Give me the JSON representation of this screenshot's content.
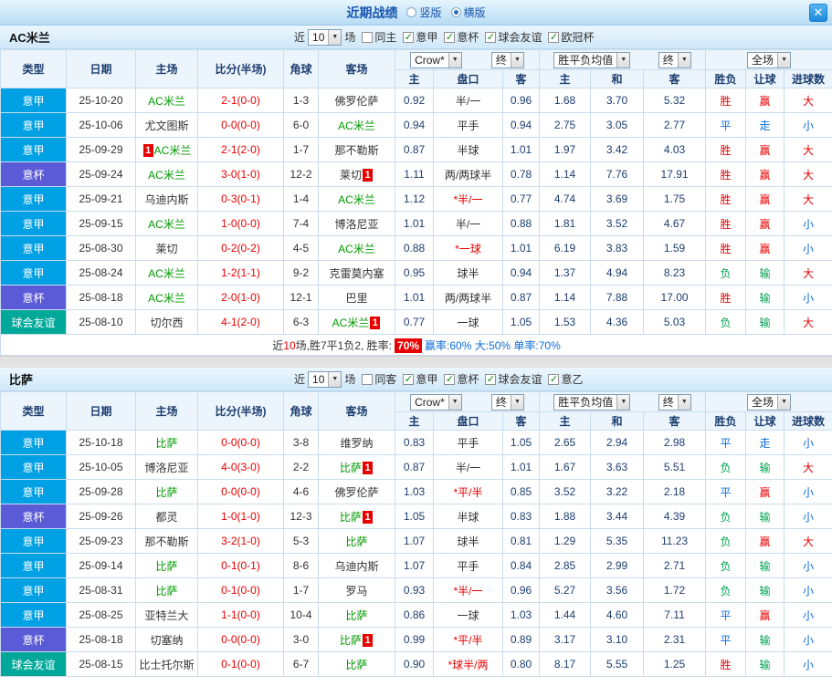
{
  "topbar": {
    "title": "近期战绩",
    "vertical_label": "竖版",
    "horizontal_label": "横版"
  },
  "icons": {
    "close": "✕",
    "dropdown": "▼",
    "check": "✓"
  },
  "table": {
    "near_label": "近",
    "matches_label": "场",
    "headers_left": [
      "类型",
      "日期",
      "主场",
      "比分(半场)",
      "角球",
      "客场"
    ],
    "headers_right": [
      "主",
      "盘口",
      "客",
      "主",
      "和",
      "客",
      "胜负",
      "让球",
      "进球数"
    ]
  },
  "league_colors": {
    "意甲": "#00a0e4",
    "意杯": "#5b5bd8",
    "球会友谊": "#00a89a"
  },
  "result_colors": {
    "r": "#e80000",
    "g": "#00a050",
    "b": "#0a6cdc"
  },
  "sections": [
    {
      "team": "AC米兰",
      "count": "10",
      "same_label": "同主",
      "leagues": [
        "意甲",
        "意杯",
        "球会友谊",
        "欧冠杯"
      ],
      "select_groups": [
        [
          "Crow*",
          "终"
        ],
        [
          "胜平负均值",
          "终"
        ],
        [
          "全场"
        ]
      ],
      "rows": [
        {
          "league": "意甲",
          "date": "25-10-20",
          "home": {
            "name": "AC米兰",
            "green": true
          },
          "score": "2-1(0-0)",
          "corner": "1-3",
          "away": {
            "name": "佛罗伦萨",
            "green": false
          },
          "crow_home": "0.92",
          "handicap": "半/一",
          "handicap_red": false,
          "crow_away": "0.96",
          "avg_home": "1.68",
          "avg_draw": "3.70",
          "avg_away": "5.32",
          "result": {
            "t": "胜",
            "c": "r"
          },
          "handicap_result": {
            "t": "赢",
            "c": "r"
          },
          "goals": {
            "t": "大",
            "c": "r"
          }
        },
        {
          "league": "意甲",
          "date": "25-10-06",
          "home": {
            "name": "尤文图斯",
            "green": false
          },
          "score": "0-0(0-0)",
          "corner": "6-0",
          "away": {
            "name": "AC米兰",
            "green": true
          },
          "crow_home": "0.94",
          "handicap": "平手",
          "handicap_red": false,
          "crow_away": "0.94",
          "avg_home": "2.75",
          "avg_draw": "3.05",
          "avg_away": "2.77",
          "result": {
            "t": "平",
            "c": "b"
          },
          "handicap_result": {
            "t": "走",
            "c": "b"
          },
          "goals": {
            "t": "小",
            "c": "b"
          }
        },
        {
          "league": "意甲",
          "date": "25-09-29",
          "home": {
            "name": "AC米兰",
            "green": true,
            "badge": "1",
            "badge_pos": "before"
          },
          "score": "2-1(2-0)",
          "corner": "1-7",
          "away": {
            "name": "那不勒斯",
            "green": false
          },
          "crow_home": "0.87",
          "handicap": "半球",
          "handicap_red": false,
          "crow_away": "1.01",
          "avg_home": "1.97",
          "avg_draw": "3.42",
          "avg_away": "4.03",
          "result": {
            "t": "胜",
            "c": "r"
          },
          "handicap_result": {
            "t": "赢",
            "c": "r"
          },
          "goals": {
            "t": "大",
            "c": "r"
          }
        },
        {
          "league": "意杯",
          "date": "25-09-24",
          "home": {
            "name": "AC米兰",
            "green": true
          },
          "score": "3-0(1-0)",
          "corner": "12-2",
          "away": {
            "name": "莱切",
            "green": false,
            "badge": "1",
            "badge_pos": "after"
          },
          "crow_home": "1.11",
          "handicap": "两/两球半",
          "handicap_red": false,
          "crow_away": "0.78",
          "avg_home": "1.14",
          "avg_draw": "7.76",
          "avg_away": "17.91",
          "result": {
            "t": "胜",
            "c": "r"
          },
          "handicap_result": {
            "t": "赢",
            "c": "r"
          },
          "goals": {
            "t": "大",
            "c": "r"
          }
        },
        {
          "league": "意甲",
          "date": "25-09-21",
          "home": {
            "name": "乌迪内斯",
            "green": false
          },
          "score": "0-3(0-1)",
          "corner": "1-4",
          "away": {
            "name": "AC米兰",
            "green": true
          },
          "crow_home": "1.12",
          "handicap": "*半/一",
          "handicap_red": true,
          "crow_away": "0.77",
          "avg_home": "4.74",
          "avg_draw": "3.69",
          "avg_away": "1.75",
          "result": {
            "t": "胜",
            "c": "r"
          },
          "handicap_result": {
            "t": "赢",
            "c": "r"
          },
          "goals": {
            "t": "大",
            "c": "r"
          }
        },
        {
          "league": "意甲",
          "date": "25-09-15",
          "home": {
            "name": "AC米兰",
            "green": true
          },
          "score": "1-0(0-0)",
          "corner": "7-4",
          "away": {
            "name": "博洛尼亚",
            "green": false
          },
          "crow_home": "1.01",
          "handicap": "半/一",
          "handicap_red": false,
          "crow_away": "0.88",
          "avg_home": "1.81",
          "avg_draw": "3.52",
          "avg_away": "4.67",
          "result": {
            "t": "胜",
            "c": "r"
          },
          "handicap_result": {
            "t": "赢",
            "c": "r"
          },
          "goals": {
            "t": "小",
            "c": "b"
          }
        },
        {
          "league": "意甲",
          "date": "25-08-30",
          "home": {
            "name": "莱切",
            "green": false
          },
          "score": "0-2(0-2)",
          "corner": "4-5",
          "away": {
            "name": "AC米兰",
            "green": true
          },
          "crow_home": "0.88",
          "handicap": "*一球",
          "handicap_red": true,
          "crow_away": "1.01",
          "avg_home": "6.19",
          "avg_draw": "3.83",
          "avg_away": "1.59",
          "result": {
            "t": "胜",
            "c": "r"
          },
          "handicap_result": {
            "t": "赢",
            "c": "r"
          },
          "goals": {
            "t": "小",
            "c": "b"
          }
        },
        {
          "league": "意甲",
          "date": "25-08-24",
          "home": {
            "name": "AC米兰",
            "green": true
          },
          "score": "1-2(1-1)",
          "corner": "9-2",
          "away": {
            "name": "克雷莫内塞",
            "green": false
          },
          "crow_home": "0.95",
          "handicap": "球半",
          "handicap_red": false,
          "crow_away": "0.94",
          "avg_home": "1.37",
          "avg_draw": "4.94",
          "avg_away": "8.23",
          "result": {
            "t": "负",
            "c": "g"
          },
          "handicap_result": {
            "t": "输",
            "c": "g"
          },
          "goals": {
            "t": "大",
            "c": "r"
          }
        },
        {
          "league": "意杯",
          "date": "25-08-18",
          "home": {
            "name": "AC米兰",
            "green": true
          },
          "score": "2-0(1-0)",
          "corner": "12-1",
          "away": {
            "name": "巴里",
            "green": false
          },
          "crow_home": "1.01",
          "handicap": "两/两球半",
          "handicap_red": false,
          "crow_away": "0.87",
          "avg_home": "1.14",
          "avg_draw": "7.88",
          "avg_away": "17.00",
          "result": {
            "t": "胜",
            "c": "r"
          },
          "handicap_result": {
            "t": "输",
            "c": "g"
          },
          "goals": {
            "t": "小",
            "c": "b"
          }
        },
        {
          "league": "球会友谊",
          "date": "25-08-10",
          "home": {
            "name": "切尔西",
            "green": false
          },
          "score": "4-1(2-0)",
          "corner": "6-3",
          "away": {
            "name": "AC米兰",
            "green": true,
            "badge": "1",
            "badge_pos": "after"
          },
          "crow_home": "0.77",
          "handicap": "一球",
          "handicap_red": false,
          "crow_away": "1.05",
          "avg_home": "1.53",
          "avg_draw": "4.36",
          "avg_away": "5.03",
          "result": {
            "t": "负",
            "c": "g"
          },
          "handicap_result": {
            "t": "输",
            "c": "g"
          },
          "goals": {
            "t": "大",
            "c": "r"
          }
        }
      ],
      "summary": [
        {
          "t": "近",
          "c": "#333333"
        },
        {
          "t": "10",
          "c": "#e80000"
        },
        {
          "t": "场,胜7平1负2, 胜率:",
          "c": "#333333"
        },
        {
          "t": "70%",
          "badge": true
        },
        {
          "t": "赢率:60% 大:50% 单率:70%",
          "c": "#0a6cdc"
        }
      ]
    },
    {
      "team": "比萨",
      "count": "10",
      "same_label": "同客",
      "leagues": [
        "意甲",
        "意杯",
        "球会友谊",
        "意乙"
      ],
      "select_groups": [
        [
          "Crow*",
          "终"
        ],
        [
          "胜平负均值",
          "终"
        ],
        [
          "全场"
        ]
      ],
      "rows": [
        {
          "league": "意甲",
          "date": "25-10-18",
          "home": {
            "name": "比萨",
            "green": true
          },
          "score": "0-0(0-0)",
          "corner": "3-8",
          "away": {
            "name": "维罗纳",
            "green": false
          },
          "crow_home": "0.83",
          "handicap": "平手",
          "handicap_red": false,
          "crow_away": "1.05",
          "avg_home": "2.65",
          "avg_draw": "2.94",
          "avg_away": "2.98",
          "result": {
            "t": "平",
            "c": "b"
          },
          "handicap_result": {
            "t": "走",
            "c": "b"
          },
          "goals": {
            "t": "小",
            "c": "b"
          }
        },
        {
          "league": "意甲",
          "date": "25-10-05",
          "home": {
            "name": "博洛尼亚",
            "green": false
          },
          "score": "4-0(3-0)",
          "corner": "2-2",
          "away": {
            "name": "比萨",
            "green": true,
            "badge": "1",
            "badge_pos": "after"
          },
          "crow_home": "0.87",
          "handicap": "半/一",
          "handicap_red": false,
          "crow_away": "1.01",
          "avg_home": "1.67",
          "avg_draw": "3.63",
          "avg_away": "5.51",
          "result": {
            "t": "负",
            "c": "g"
          },
          "handicap_result": {
            "t": "输",
            "c": "g"
          },
          "goals": {
            "t": "大",
            "c": "r"
          }
        },
        {
          "league": "意甲",
          "date": "25-09-28",
          "home": {
            "name": "比萨",
            "green": true
          },
          "score": "0-0(0-0)",
          "corner": "4-6",
          "away": {
            "name": "佛罗伦萨",
            "green": false
          },
          "crow_home": "1.03",
          "handicap": "*平/半",
          "handicap_red": true,
          "crow_away": "0.85",
          "avg_home": "3.52",
          "avg_draw": "3.22",
          "avg_away": "2.18",
          "result": {
            "t": "平",
            "c": "b"
          },
          "handicap_result": {
            "t": "赢",
            "c": "r"
          },
          "goals": {
            "t": "小",
            "c": "b"
          }
        },
        {
          "league": "意杯",
          "date": "25-09-26",
          "home": {
            "name": "都灵",
            "green": false
          },
          "score": "1-0(1-0)",
          "corner": "12-3",
          "away": {
            "name": "比萨",
            "green": true,
            "badge": "1",
            "badge_pos": "after"
          },
          "crow_home": "1.05",
          "handicap": "半球",
          "handicap_red": false,
          "crow_away": "0.83",
          "avg_home": "1.88",
          "avg_draw": "3.44",
          "avg_away": "4.39",
          "result": {
            "t": "负",
            "c": "g"
          },
          "handicap_result": {
            "t": "输",
            "c": "g"
          },
          "goals": {
            "t": "小",
            "c": "b"
          }
        },
        {
          "league": "意甲",
          "date": "25-09-23",
          "home": {
            "name": "那不勒斯",
            "green": false
          },
          "score": "3-2(1-0)",
          "corner": "5-3",
          "away": {
            "name": "比萨",
            "green": true
          },
          "crow_home": "1.07",
          "handicap": "球半",
          "handicap_red": false,
          "crow_away": "0.81",
          "avg_home": "1.29",
          "avg_draw": "5.35",
          "avg_away": "11.23",
          "result": {
            "t": "负",
            "c": "g"
          },
          "handicap_result": {
            "t": "赢",
            "c": "r"
          },
          "goals": {
            "t": "大",
            "c": "r"
          }
        },
        {
          "league": "意甲",
          "date": "25-09-14",
          "home": {
            "name": "比萨",
            "green": true
          },
          "score": "0-1(0-1)",
          "corner": "8-6",
          "away": {
            "name": "乌迪内斯",
            "green": false
          },
          "crow_home": "1.07",
          "handicap": "平手",
          "handicap_red": false,
          "crow_away": "0.84",
          "avg_home": "2.85",
          "avg_draw": "2.99",
          "avg_away": "2.71",
          "result": {
            "t": "负",
            "c": "g"
          },
          "handicap_result": {
            "t": "输",
            "c": "g"
          },
          "goals": {
            "t": "小",
            "c": "b"
          }
        },
        {
          "league": "意甲",
          "date": "25-08-31",
          "home": {
            "name": "比萨",
            "green": true
          },
          "score": "0-1(0-0)",
          "corner": "1-7",
          "away": {
            "name": "罗马",
            "green": false
          },
          "crow_home": "0.93",
          "handicap": "*半/一",
          "handicap_red": true,
          "crow_away": "0.96",
          "avg_home": "5.27",
          "avg_draw": "3.56",
          "avg_away": "1.72",
          "result": {
            "t": "负",
            "c": "g"
          },
          "handicap_result": {
            "t": "输",
            "c": "g"
          },
          "goals": {
            "t": "小",
            "c": "b"
          }
        },
        {
          "league": "意甲",
          "date": "25-08-25",
          "home": {
            "name": "亚特兰大",
            "green": false
          },
          "score": "1-1(0-0)",
          "corner": "10-4",
          "away": {
            "name": "比萨",
            "green": true
          },
          "crow_home": "0.86",
          "handicap": "一球",
          "handicap_red": false,
          "crow_away": "1.03",
          "avg_home": "1.44",
          "avg_draw": "4.60",
          "avg_away": "7.11",
          "result": {
            "t": "平",
            "c": "b"
          },
          "handicap_result": {
            "t": "赢",
            "c": "r"
          },
          "goals": {
            "t": "小",
            "c": "b"
          }
        },
        {
          "league": "意杯",
          "date": "25-08-18",
          "home": {
            "name": "切塞纳",
            "green": false
          },
          "score": "0-0(0-0)",
          "corner": "3-0",
          "away": {
            "name": "比萨",
            "green": true,
            "badge": "1",
            "badge_pos": "after"
          },
          "crow_home": "0.99",
          "handicap": "*平/半",
          "handicap_red": true,
          "crow_away": "0.89",
          "avg_home": "3.17",
          "avg_draw": "3.10",
          "avg_away": "2.31",
          "result": {
            "t": "平",
            "c": "b"
          },
          "handicap_result": {
            "t": "输",
            "c": "g"
          },
          "goals": {
            "t": "小",
            "c": "b"
          }
        },
        {
          "league": "球会友谊",
          "date": "25-08-15",
          "home": {
            "name": "比士托尔斯",
            "green": false
          },
          "score": "0-1(0-0)",
          "corner": "6-7",
          "away": {
            "name": "比萨",
            "green": true
          },
          "crow_home": "0.90",
          "handicap": "*球半/两",
          "handicap_red": true,
          "crow_away": "0.80",
          "avg_home": "8.17",
          "avg_draw": "5.55",
          "avg_away": "1.25",
          "result": {
            "t": "胜",
            "c": "r"
          },
          "handicap_result": {
            "t": "输",
            "c": "g"
          },
          "goals": {
            "t": "小",
            "c": "b"
          }
        }
      ]
    }
  ]
}
